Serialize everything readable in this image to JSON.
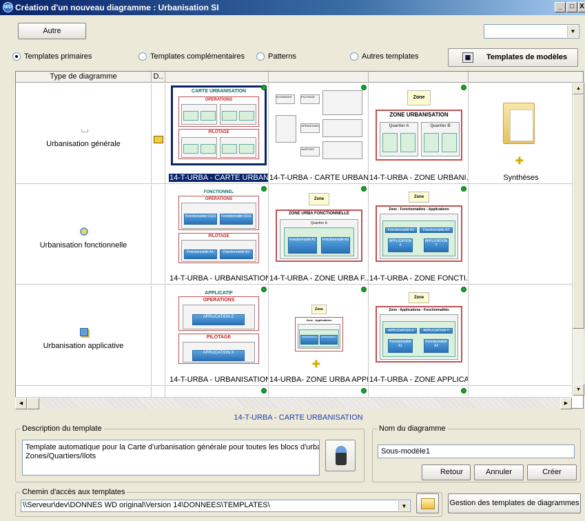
{
  "window": {
    "title": "Création d'un nouveau diagramme : Urbanisation SI",
    "app_icon": "WD",
    "min": "_",
    "max": "□",
    "close": "X"
  },
  "top": {
    "autre_label": "Autre",
    "combo_value": "",
    "combo_arrow": "▼"
  },
  "radios": [
    {
      "label": "Templates primaires",
      "checked": true
    },
    {
      "label": "Templates complémentaires",
      "checked": false
    },
    {
      "label": "Patterns",
      "checked": false
    },
    {
      "label": "Autres templates",
      "checked": false
    }
  ],
  "templates_button": {
    "label": "Templates de modèles",
    "icon": "template-gallery-icon"
  },
  "grid": {
    "columns": [
      "Type de diagramme",
      "D.."
    ],
    "rows": [
      {
        "type": "Urbanisation générale",
        "icon": "blank-page-icon",
        "tiles": [
          "14-T-URBA - CARTE URBAN...",
          "14-T-URBA - CARTE URBAN...",
          "14-T-URBA - ZONE URBANI...",
          "Synthèses"
        ]
      },
      {
        "type": "Urbanisation fonctionnelle",
        "icon": "gears-icon",
        "tiles": [
          "14-T-URBA - URBANISATION...",
          "14-T-URBA - ZONE URBA F...",
          "14-T-URBA - ZONE FONCTI..."
        ]
      },
      {
        "type": "Urbanisation applicative",
        "icon": "application-icon",
        "tiles": [
          "14-T-URBA - URBANISATION...",
          "14-URBA- ZONE URBA APPL...",
          "14-T-URBA - ZONE APPLICA..."
        ]
      }
    ],
    "thumb_texts": {
      "carte": {
        "title": "CARTE URBANISATION",
        "ops": "OPERATIONS",
        "q1": "Quartier O1",
        "q2": "Quartier O2",
        "i1": "Ilot O11",
        "i2": "Ilot O12",
        "i3": "Ilot O21",
        "i4": "Ilot O22",
        "pil": "PILOTAGE",
        "qa": "Quartier A",
        "qb": "Quartier B",
        "ia1": "Ilot A1",
        "ia2": "Ilot A2",
        "ib1": "Ilot B1",
        "ib2": "Ilot B2"
      },
      "carte2": {
        "b1": "ECHANGES",
        "b2": "PILOTAGE",
        "b3": "OPERATIONS",
        "b4": "SUPPORT"
      },
      "zone": {
        "zone": "Zone",
        "title": "ZONE URBANISATION",
        "qa": "Quartier A",
        "qb": "Quartier B",
        "a1": "Ilot A1",
        "a2": "Ilot A2",
        "b1": "Ilot B1",
        "b2": "Ilot B2"
      },
      "fonc": {
        "title": "FONCTIONNEL",
        "ops": "OPERATIONS",
        "q": "Quartier O1",
        "i": "Ilot O11",
        "f1": "Fonctionnalité O121",
        "f2": "Fonctionnalité O111",
        "pil": "PILOTAGE",
        "qa": "Quartier A",
        "ia": "Ilot A1",
        "fa1": "Fonctionnalité A1",
        "fa2": "Fonctionnalité A2"
      },
      "zf": {
        "zone": "Zone",
        "title": "ZONE URBA FONCTIONNELLE",
        "qa": "Quartier A",
        "ia": "Ilot A1",
        "f1": "Fonctionnalité A1",
        "f2": "Fonctionnalité A2"
      },
      "zfa": {
        "zone": "Zone",
        "title": "Zone - Fonctionnalites - Applications",
        "qa": "Quartier A",
        "ia": "Ilot A1",
        "fa1": "Fonctionnalité A1",
        "fa2": "Fonctionnalité A2",
        "ax": "APPLICATION X",
        "ay": "APPLICATION Y"
      },
      "app": {
        "title": "APPLICATIF",
        "ops": "OPERATIONS",
        "q": "Quartier O1",
        "i": "Ilot O11",
        "a": "APPLICATION Z",
        "pil": "PILOTAGE",
        "qa": "Quartier A",
        "ia": "Ilot A1",
        "ax": "APPLICATION X"
      },
      "za": {
        "zone": "Zone",
        "title": "Zone - Applications",
        "qa": "Quartier A",
        "ia": "Ilot A1",
        "ax": "APPLICATION X",
        "ay": "APPLICATION Y"
      },
      "zaf": {
        "zone": "Zone",
        "title": "Zone - Applications - Fonctionnalités",
        "qa": "Quartier A",
        "ia": "Ilot A1",
        "ax": "APPLICATION X",
        "ay": "APPLICATION Y",
        "f1": "Fonctionnalité A1",
        "f2": "Fonctionnalité A2"
      }
    }
  },
  "selected_template": "14-T-URBA - CARTE URBANISATION",
  "description": {
    "legend": "Description du template",
    "text": "Template automatique pour la Carte d'urbanisation générale pour toutes les blocs d'urbanisa\nZones/Quartiers/Ilots"
  },
  "diagram_name": {
    "legend": "Nom du diagramme",
    "value": "Sous-modèle1"
  },
  "buttons": {
    "retour": "Retour",
    "annuler": "Annuler",
    "creer": "Créer",
    "gestion": "Gestion des templates de diagrammes"
  },
  "path": {
    "legend": "Chemin d'accès aux templates",
    "value": "\\\\Serveur\\dev\\DONNES WD original\\Version 14\\DONNEES\\TEMPLATES\\"
  },
  "colors": {
    "title_start": "#0a246a",
    "selection": "#0a246a",
    "status_green": "#1a9e2a",
    "name_blue": "#1c3fb0"
  }
}
